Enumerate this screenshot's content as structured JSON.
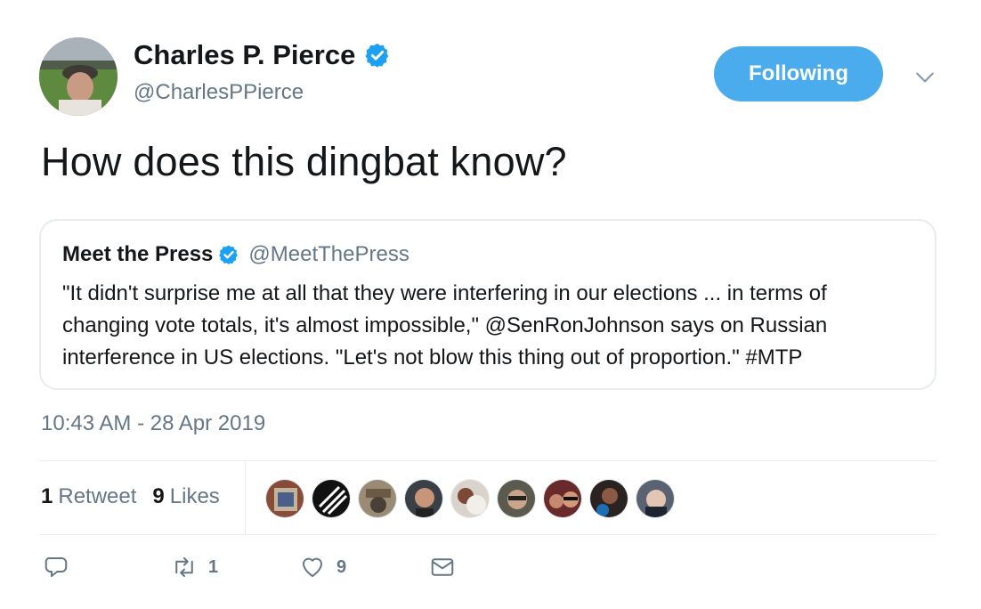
{
  "author": {
    "name": "Charles P. Pierce",
    "handle": "@CharlesPPierce"
  },
  "follow_button": {
    "label": "Following"
  },
  "tweet": {
    "text": "How does this dingbat know?",
    "timestamp": "10:43 AM - 28 Apr 2019"
  },
  "quote": {
    "name": "Meet the Press",
    "handle": "@MeetThePress",
    "body": "\"It didn't surprise me at all that they were interfering in our elections ... in terms of changing vote totals, it's almost impossible,\" @SenRonJohnson says on Russian interference in US elections. \"Let's not blow this thing out of proportion.\" #MTP"
  },
  "stats": {
    "retweets_count": "1",
    "retweets_label": "Retweet",
    "likes_count": "9",
    "likes_label": "Likes"
  },
  "action_bar": {
    "reply_count": "",
    "retweet_count": "1",
    "like_count": "9"
  },
  "colors": {
    "accent": "#1da1f2",
    "follow_bg": "#4aabed",
    "muted": "#657786",
    "border": "#e6ecf0"
  },
  "icons": [
    "verified-badge-icon",
    "chevron-down-icon",
    "reply-icon",
    "retweet-icon",
    "heart-icon",
    "direct-message-icon"
  ]
}
